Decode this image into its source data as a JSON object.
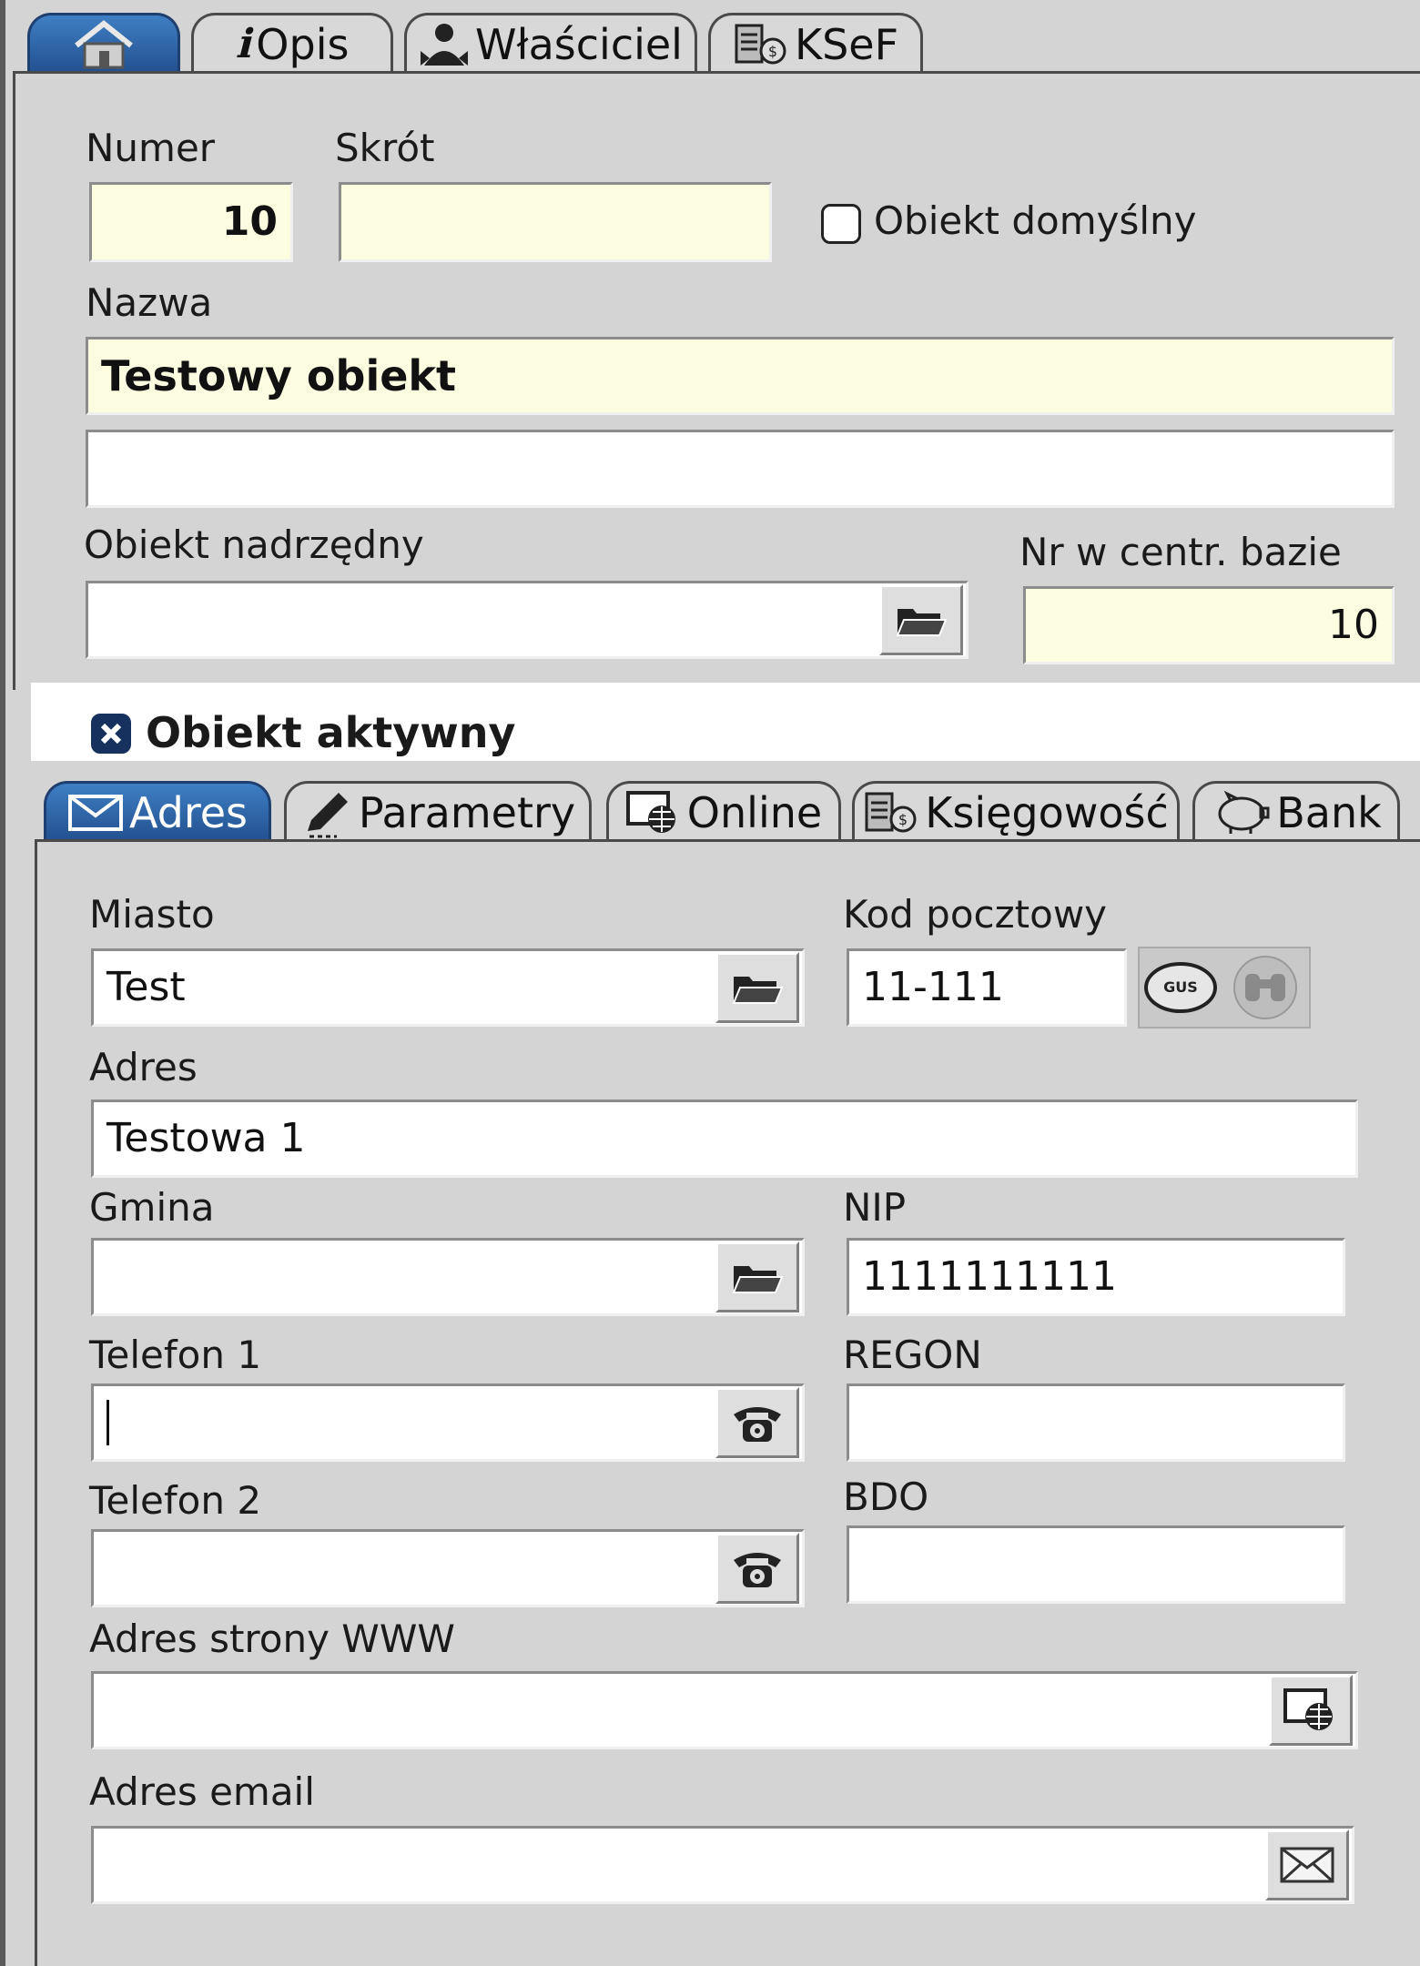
{
  "top_tabs": [
    {
      "label": "",
      "icon": "home-icon",
      "active": true
    },
    {
      "label": "Opis",
      "icon": "info-icon",
      "active": false
    },
    {
      "label": "Właściciel",
      "icon": "owner-icon",
      "active": false
    },
    {
      "label": "KSeF",
      "icon": "ksef-icon",
      "active": false
    }
  ],
  "form": {
    "numer_label": "Numer",
    "numer_value": "10",
    "skrot_label": "Skrót",
    "skrot_value": "",
    "default_object_label": "Obiekt domyślny",
    "default_object_checked": false,
    "nazwa_label": "Nazwa",
    "nazwa_value": "Testowy obiekt",
    "nazwa2_value": "",
    "parent_label": "Obiekt nadrzędny",
    "parent_value": "",
    "central_nr_label": "Nr w centr. bazie",
    "central_nr_value": "10",
    "active_label": "Obiekt aktywny",
    "active_checked": true
  },
  "bottom_tabs": [
    {
      "label": "Adres",
      "icon": "envelope-icon",
      "active": true
    },
    {
      "label": "Parametry",
      "icon": "pencil-icon",
      "active": false
    },
    {
      "label": "Online",
      "icon": "globe-monitor-icon",
      "active": false
    },
    {
      "label": "Księgowość",
      "icon": "ksef-icon",
      "active": false
    },
    {
      "label": "Bank",
      "icon": "piggy-bank-icon",
      "active": false
    }
  ],
  "address": {
    "miasto_label": "Miasto",
    "miasto_value": "Test",
    "kod_label": "Kod pocztowy",
    "kod_value": "11-111",
    "gus_label": "GUS",
    "adres_label": "Adres",
    "adres_value": "Testowa 1",
    "gmina_label": "Gmina",
    "gmina_value": "",
    "nip_label": "NIP",
    "nip_value": "1111111111",
    "tel1_label": "Telefon 1",
    "tel1_value": "",
    "regon_label": "REGON",
    "regon_value": "",
    "tel2_label": "Telefon 2",
    "tel2_value": "",
    "bdo_label": "BDO",
    "bdo_value": "",
    "www_label": "Adres strony WWW",
    "www_value": "",
    "email_label": "Adres email",
    "email_value": ""
  },
  "colors": {
    "active_tab": "#2f6bb0",
    "field_yellow": "#fbfce0",
    "background": "#d4d4d4"
  }
}
